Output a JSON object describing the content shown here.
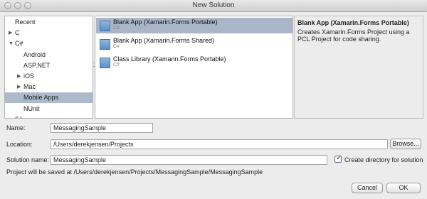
{
  "window": {
    "title": "New Solution"
  },
  "categories": [
    {
      "label": "Recent",
      "arrow": "",
      "indent": 0,
      "selected": false
    },
    {
      "label": "C",
      "arrow": "▶",
      "indent": 0,
      "selected": false
    },
    {
      "label": "C#",
      "arrow": "▼",
      "indent": 0,
      "selected": false
    },
    {
      "label": "Android",
      "arrow": "",
      "indent": 1,
      "selected": false
    },
    {
      "label": "ASP.NET",
      "arrow": "",
      "indent": 1,
      "selected": false
    },
    {
      "label": "iOS",
      "arrow": "▶",
      "indent": 1,
      "selected": false
    },
    {
      "label": "Mac",
      "arrow": "▶",
      "indent": 1,
      "selected": false
    },
    {
      "label": "Mobile Apps",
      "arrow": "",
      "indent": 1,
      "selected": true
    },
    {
      "label": "NUnit",
      "arrow": "",
      "indent": 1,
      "selected": false
    },
    {
      "label": "F#",
      "arrow": "▶",
      "indent": 0,
      "selected": false
    }
  ],
  "templates": [
    {
      "name": "Blank App (Xamarin.Forms Portable)",
      "lang": "C#",
      "selected": true
    },
    {
      "name": "Blank App (Xamarin.Forms Shared)",
      "lang": "C#",
      "selected": false
    },
    {
      "name": "Class Library (Xamarin.Forms Portable)",
      "lang": "C#",
      "selected": false
    }
  ],
  "description": {
    "title": "Blank App (Xamarin.Forms Portable)",
    "text": "Creates Xamarin.Forms Project using a PCL Project for code sharing."
  },
  "form": {
    "name_label": "Name:",
    "name_value": "MessagingSample",
    "location_label": "Location:",
    "location_value": "/Users/derekjensen/Projects",
    "browse_label": "Browse...",
    "solution_label": "Solution name:",
    "solution_value": "MessagingSample",
    "create_dir_label": "Create directory for solution",
    "create_dir_checked": true,
    "info_text": "Project will be saved at /Users/derekjensen/Projects/MessagingSample/MessagingSample"
  },
  "buttons": {
    "cancel": "Cancel",
    "ok": "OK"
  }
}
